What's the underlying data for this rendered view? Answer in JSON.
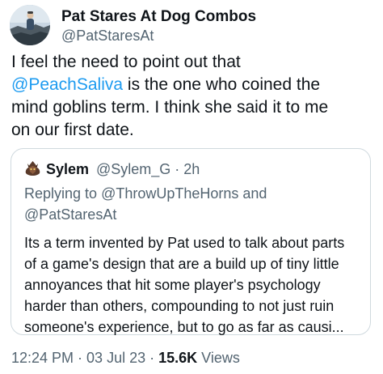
{
  "author": {
    "display_name": "Pat Stares At Dog Combos",
    "handle": "@PatStaresAt"
  },
  "tweet": {
    "line1": "I feel the need to point out that",
    "mention": "@PeachSaliva",
    "line2_rest": " is the one who coined the",
    "line3": "mind goblins term. I think she said it to me",
    "line4": "on our first date."
  },
  "quote": {
    "display_name": "Sylem",
    "meta": "@Sylem_G · 2h",
    "replying_prefix": "Replying to ",
    "replying_to_1": "@ThrowUpTheHorns",
    "replying_and": " and",
    "replying_to_2": "@PatStaresAt",
    "body": [
      "Its a term invented by Pat used to talk about parts",
      "of a game's design that are a build up of tiny little",
      "annoyances that hit some player's psychology",
      "harder than others, compounding to not just ruin",
      "someone's experience, but to go as far as causi..."
    ]
  },
  "footer": {
    "time": "12:24 PM",
    "sep1": " · ",
    "date": "03 Jul 23",
    "sep2": " · ",
    "views_count": "15.6K",
    "views_label": " Views"
  },
  "colors": {
    "text": "#0f1419",
    "secondary": "#536471",
    "link": "#1d9bf0",
    "border": "#cfd9de"
  }
}
